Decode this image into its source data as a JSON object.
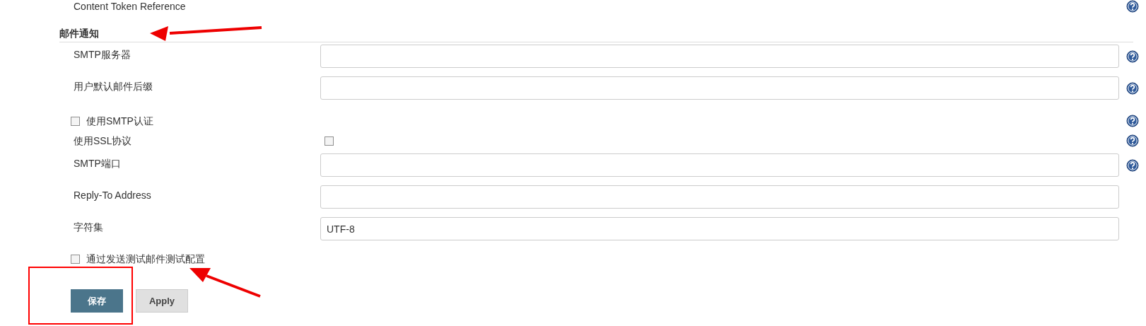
{
  "top_item": {
    "label": "Content Token Reference",
    "help": true
  },
  "section": {
    "title": "邮件通知"
  },
  "rows": [
    {
      "kind": "text",
      "label": "SMTP服务器",
      "help": true
    },
    {
      "kind": "text",
      "label": "用户默认邮件后缀",
      "help": true
    },
    {
      "kind": "check_left",
      "label": "使用SMTP认证",
      "checked": false,
      "help": true
    },
    {
      "kind": "check_right",
      "label": "使用SSL协议",
      "checked": false,
      "help": true
    },
    {
      "kind": "text",
      "label": "SMTP端口",
      "help": true
    },
    {
      "kind": "text",
      "label": "Reply-To Address",
      "help": false
    },
    {
      "kind": "text",
      "label": "字符集",
      "value": "UTF-8",
      "help": false
    },
    {
      "kind": "check_left",
      "label": "通过发送测试邮件测试配置",
      "checked": false,
      "help": false
    }
  ],
  "buttons": [
    {
      "label": "保存",
      "kind": "primary"
    },
    {
      "label": "Apply",
      "kind": "secondary"
    }
  ]
}
